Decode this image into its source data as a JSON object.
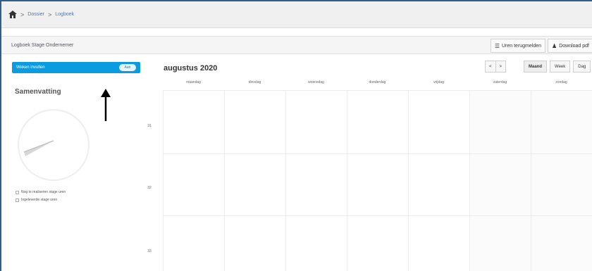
{
  "breadcrumb": {
    "items": [
      "Dossier",
      "Logboek"
    ],
    "separator": ">"
  },
  "header": {
    "title": "Logboek Stage Ondernemer",
    "buttons": [
      {
        "label": "Uren terugmelden",
        "icon": "list-icon"
      },
      {
        "label": "Download pdf",
        "icon": "person-icon"
      }
    ]
  },
  "sidebar": {
    "toggle_label": "Weken invullen",
    "toggle_state": "Aan",
    "summary_title": "Samenvatting",
    "legend": [
      {
        "label": "Nog te realiseren stage uren"
      },
      {
        "label": "Ingeleverde stage uren"
      }
    ]
  },
  "calendar": {
    "title": "augustus 2020",
    "nav": [
      "<",
      ">"
    ],
    "views": [
      "Maand",
      "Week",
      "Dag"
    ],
    "active_view": "Maand",
    "days": [
      "maandag",
      "dinsdag",
      "woensdag",
      "donderdag",
      "vrijdag",
      "zaterdag",
      "zondag"
    ],
    "weeks": [
      "31",
      "32",
      "33"
    ]
  },
  "colors": {
    "accent": "#0b9be0",
    "frame": "#2f5f8a",
    "header_bg": "#f0f0f0"
  }
}
